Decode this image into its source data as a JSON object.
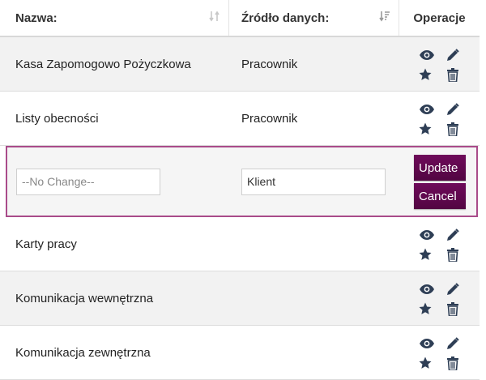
{
  "header": {
    "col_name": "Nazwa:",
    "col_source": "Źródło danych:",
    "col_ops": "Operacje"
  },
  "rows": [
    {
      "name": "Kasa Zapomogowo Pożyczkowa",
      "source": "Pracownik"
    },
    {
      "name": "Listy obecności",
      "source": "Pracownik"
    },
    {
      "name": "Karty pracy",
      "source": ""
    },
    {
      "name": "Komunikacja wewnętrzna",
      "source": ""
    },
    {
      "name": "Komunikacja zewnętrzna",
      "source": ""
    }
  ],
  "edit_row": {
    "name_placeholder": "--No Change--",
    "source_value": "Klient",
    "update_label": "Update",
    "cancel_label": "Cancel"
  },
  "colors": {
    "accent": "#5e0850",
    "edit_border": "#a94b8a",
    "icon": "#2e3e55"
  },
  "icons": [
    "eye-icon",
    "pencil-icon",
    "star-icon",
    "trash-icon",
    "sort-icon"
  ]
}
